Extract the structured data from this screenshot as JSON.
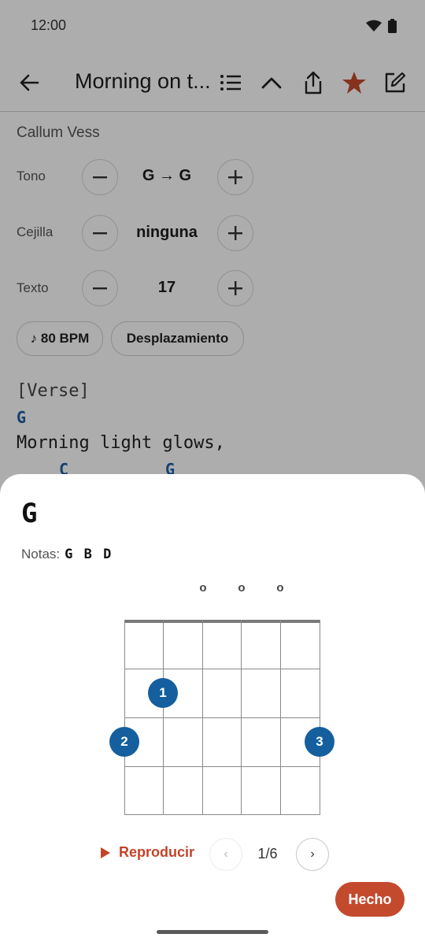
{
  "status_bar": {
    "time": "12:00"
  },
  "toolbar": {
    "title": "Morning on t..."
  },
  "song": {
    "artist": "Callum Vess"
  },
  "controls": [
    {
      "label": "Tono",
      "value": "G → G"
    },
    {
      "label": "Cejilla",
      "value": "ninguna"
    },
    {
      "label": "Texto",
      "value": "17"
    }
  ],
  "chips": {
    "tempo": "♪ 80 BPM",
    "scroll": "Desplazamiento"
  },
  "lyrics": {
    "section": "[Verse]",
    "chord_line_1": "G",
    "lyric_line_1": "Morning light glows,",
    "chord_line_2_a": "C",
    "chord_line_2_b": "G"
  },
  "chord_sheet": {
    "name": "G",
    "notes_label": "Notas:",
    "notes_value": "G B D",
    "open_marker": "o",
    "fingers": [
      "1",
      "2",
      "3"
    ],
    "play_label": "Reproducir",
    "prev_label": "‹",
    "next_label": "›",
    "counter": "1/6",
    "done_label": "Hecho"
  },
  "colors": {
    "accent": "#c44a2e",
    "chord_blue": "#1e5fa8",
    "finger_dot": "#155f9e"
  }
}
